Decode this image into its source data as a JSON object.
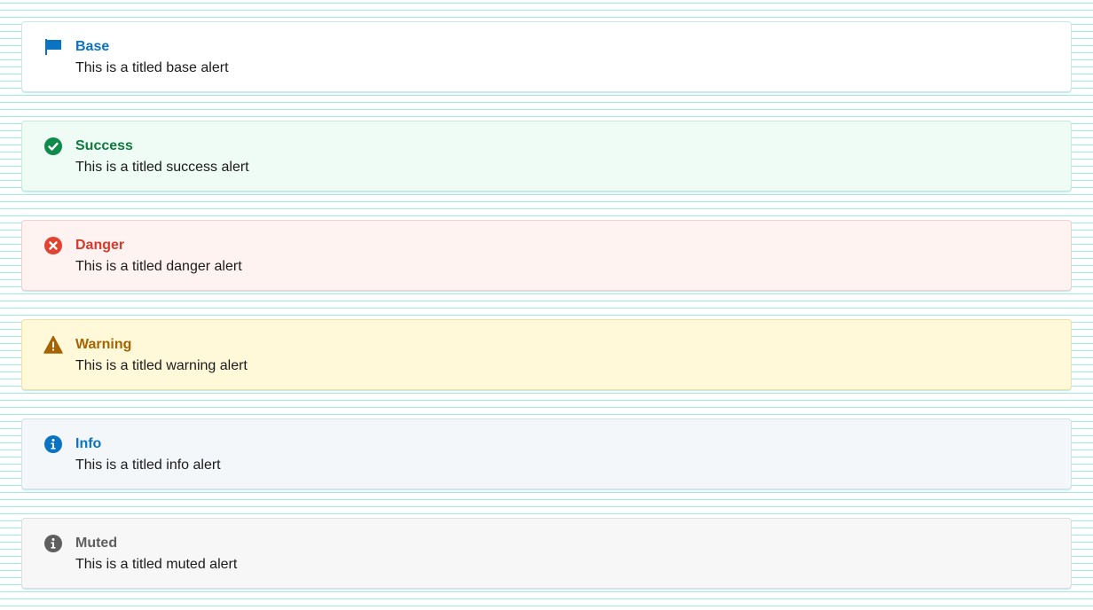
{
  "alerts": [
    {
      "title": "Base",
      "message": "This is a titled base alert",
      "icon": "flag-icon",
      "color": "#0a74c2"
    },
    {
      "title": "Success",
      "message": "This is a titled success alert",
      "icon": "check-circle-icon",
      "color": "#0f7a3e"
    },
    {
      "title": "Danger",
      "message": "This is a titled danger alert",
      "icon": "x-circle-icon",
      "color": "#d63a2a"
    },
    {
      "title": "Warning",
      "message": "This is a titled warning alert",
      "icon": "warning-triangle-icon",
      "color": "#a66300"
    },
    {
      "title": "Info",
      "message": "This is a titled info alert",
      "icon": "info-circle-icon",
      "color": "#0a74c2"
    },
    {
      "title": "Muted",
      "message": "This is a titled muted alert",
      "icon": "info-circle-icon",
      "color": "#5f5f5f"
    }
  ]
}
